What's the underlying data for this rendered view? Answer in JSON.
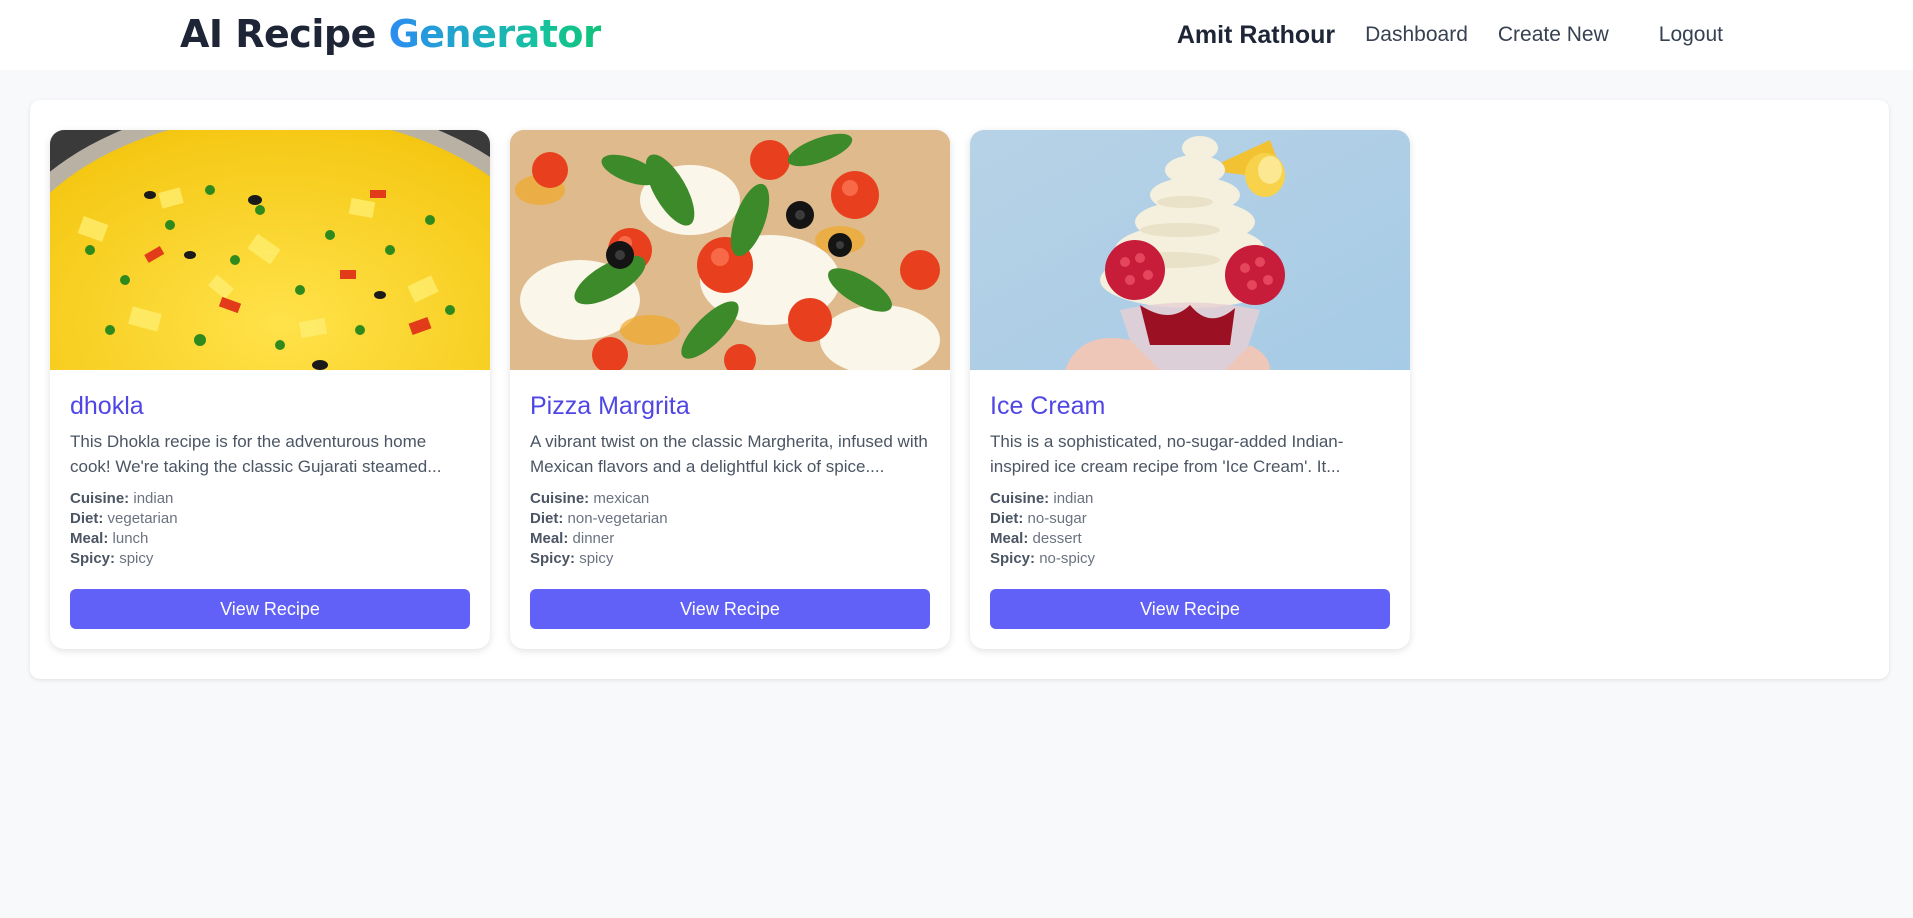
{
  "header": {
    "brand_part1": "AI Recipe ",
    "brand_part2": "Generator",
    "user_name": "Amit Rathour",
    "nav": {
      "dashboard": "Dashboard",
      "create_new": "Create New",
      "logout": "Logout"
    }
  },
  "colors": {
    "accent": "#6160f7",
    "title": "#4f46e5",
    "brand_gradient_start": "#2b8cf2",
    "brand_gradient_end": "#10c27a"
  },
  "labels": {
    "cuisine": "Cuisine:",
    "diet": "Diet:",
    "meal": "Meal:",
    "spicy": "Spicy:"
  },
  "recipes": [
    {
      "title": "dhokla",
      "description": "This Dhokla recipe is for the adventurous home cook! We're taking the classic Gujarati steamed...",
      "cuisine": "indian",
      "diet": "vegetarian",
      "meal": "lunch",
      "spicy": "spicy",
      "button": "View Recipe"
    },
    {
      "title": "Pizza Margrita",
      "description": "A vibrant twist on the classic Margherita, infused with Mexican flavors and a delightful kick of spice....",
      "cuisine": "mexican",
      "diet": "non-vegetarian",
      "meal": "dinner",
      "spicy": "spicy",
      "button": "View Recipe"
    },
    {
      "title": "Ice Cream",
      "description": "This is a sophisticated, no-sugar-added Indian-inspired ice cream recipe from 'Ice Cream'. It...",
      "cuisine": "indian",
      "diet": "no-sugar",
      "meal": "dessert",
      "spicy": "no-spicy",
      "button": "View Recipe"
    }
  ]
}
